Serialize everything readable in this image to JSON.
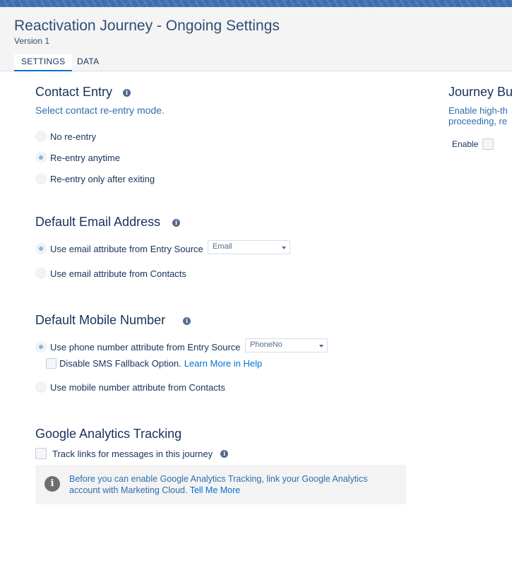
{
  "header": {
    "title": "Reactivation Journey - Ongoing Settings",
    "version": "Version 1",
    "tabs": [
      {
        "label": "SETTINGS",
        "active": true
      },
      {
        "label": "DATA",
        "active": false
      }
    ]
  },
  "contact_entry": {
    "title": "Contact Entry",
    "subtitle": "Select contact re-entry mode.",
    "options": [
      {
        "label": "No re-entry",
        "selected": false
      },
      {
        "label": "Re-entry anytime",
        "selected": true
      },
      {
        "label": "Re-entry only after exiting",
        "selected": false
      }
    ]
  },
  "default_email": {
    "title": "Default Email Address",
    "option_entry_source": "Use email attribute from Entry Source",
    "option_contacts": "Use email attribute from Contacts",
    "select_value": "Email"
  },
  "default_mobile": {
    "title": "Default Mobile Number",
    "option_entry_source": "Use phone number attribute from Entry Source",
    "select_value": "PhoneNo",
    "sms_fallback_label": "Disable SMS Fallback Option.",
    "learn_more": "Learn More in Help",
    "option_contacts": "Use mobile number attribute from Contacts"
  },
  "google_analytics": {
    "title": "Google Analytics Tracking",
    "track_label": "Track links for messages in this journey",
    "notice_text": "Before you can enable Google Analytics Tracking, link your Google Analytics account with Marketing Cloud.",
    "notice_link": "Tell Me More"
  },
  "journey_builder": {
    "title": "Journey Bu",
    "desc_line1": "Enable high-th",
    "desc_line2": "proceeding, re",
    "enable_label": "Enable"
  },
  "colors": {
    "accent": "#0070d2",
    "title_text": "#16325c",
    "banner": "#3d6fb0"
  },
  "icons": {
    "info": "info-icon",
    "caret": "chevron-down-icon"
  }
}
